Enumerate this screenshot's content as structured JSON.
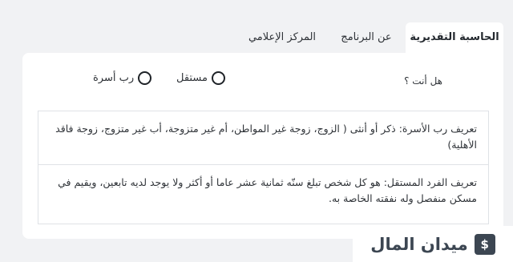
{
  "tabs": [
    {
      "label": "الحاسبة التقديرية",
      "active": true
    },
    {
      "label": "عن البرنامج",
      "active": false
    },
    {
      "label": "المركز الإعلامي",
      "active": false
    }
  ],
  "form": {
    "question": "هل أنت ؟",
    "options": [
      "مستقل",
      "رب أسرة"
    ]
  },
  "definitions": [
    "تعريف رب الأسرة: ذكر أو أنثى ( الزوج، زوجة غير المواطن، أم غير متزوجة، أب غير متزوج، زوجة فاقد الأهلية)",
    "تعريف الفرد المستقل: هو كل شخص تبلغ سنّه ثمانية عشر عاما أو أكثر ولا يوجد لديه تابعين، ويقيم في مسكن منفصل وله نفقته الخاصة به."
  ],
  "watermark": {
    "text": "ميدان المال",
    "icon": "money-bag-icon"
  }
}
